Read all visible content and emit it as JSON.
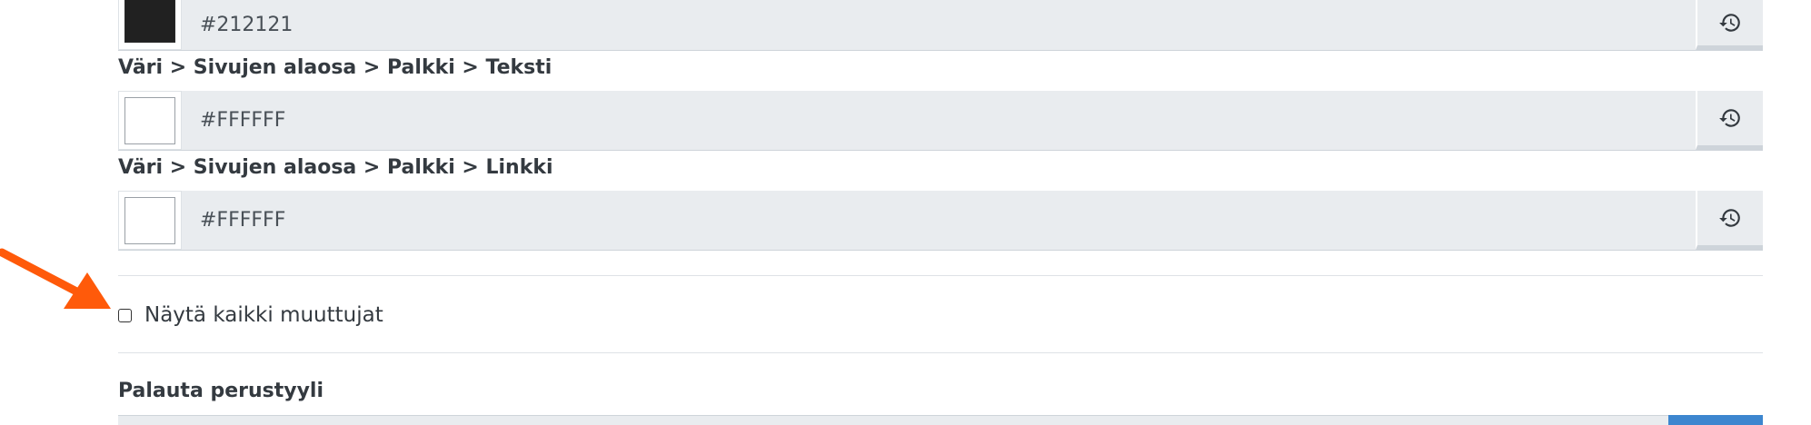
{
  "color_fields": [
    {
      "label": "",
      "value": "#212121",
      "swatch_color": "#212121"
    },
    {
      "label": "Väri > Sivujen alaosa > Palkki > Teksti",
      "value": "#FFFFFF",
      "swatch_color": "#FFFFFF"
    },
    {
      "label": "Väri > Sivujen alaosa > Palkki > Linkki",
      "value": "#FFFFFF",
      "swatch_color": "#FFFFFF"
    }
  ],
  "reset_icon": "history-icon",
  "show_all_variables": {
    "label": "Näytä kaikki muuttujat",
    "checked": false
  },
  "reset_style": {
    "label": "Palauta perustyyli"
  },
  "annotation": {
    "arrow_color": "#FF5A0A",
    "icon": "arrow-icon"
  },
  "colors": {
    "input_bg": "#e9ecef",
    "primary_button": "#3d86cf"
  }
}
